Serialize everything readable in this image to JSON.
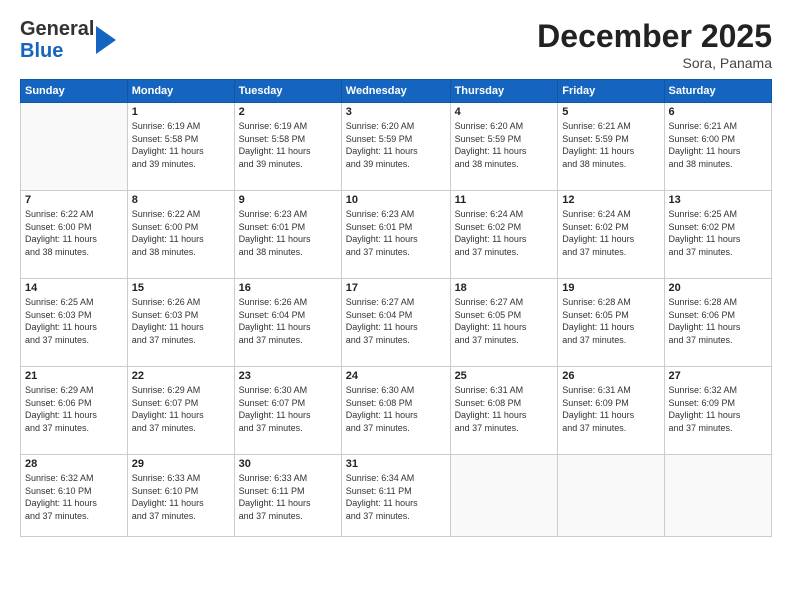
{
  "header": {
    "logo_general": "General",
    "logo_blue": "Blue",
    "month_title": "December 2025",
    "location": "Sora, Panama"
  },
  "weekdays": [
    "Sunday",
    "Monday",
    "Tuesday",
    "Wednesday",
    "Thursday",
    "Friday",
    "Saturday"
  ],
  "weeks": [
    [
      {
        "day": "",
        "info": ""
      },
      {
        "day": "1",
        "info": "Sunrise: 6:19 AM\nSunset: 5:58 PM\nDaylight: 11 hours\nand 39 minutes."
      },
      {
        "day": "2",
        "info": "Sunrise: 6:19 AM\nSunset: 5:58 PM\nDaylight: 11 hours\nand 39 minutes."
      },
      {
        "day": "3",
        "info": "Sunrise: 6:20 AM\nSunset: 5:59 PM\nDaylight: 11 hours\nand 39 minutes."
      },
      {
        "day": "4",
        "info": "Sunrise: 6:20 AM\nSunset: 5:59 PM\nDaylight: 11 hours\nand 38 minutes."
      },
      {
        "day": "5",
        "info": "Sunrise: 6:21 AM\nSunset: 5:59 PM\nDaylight: 11 hours\nand 38 minutes."
      },
      {
        "day": "6",
        "info": "Sunrise: 6:21 AM\nSunset: 6:00 PM\nDaylight: 11 hours\nand 38 minutes."
      }
    ],
    [
      {
        "day": "7",
        "info": "Sunrise: 6:22 AM\nSunset: 6:00 PM\nDaylight: 11 hours\nand 38 minutes."
      },
      {
        "day": "8",
        "info": "Sunrise: 6:22 AM\nSunset: 6:00 PM\nDaylight: 11 hours\nand 38 minutes."
      },
      {
        "day": "9",
        "info": "Sunrise: 6:23 AM\nSunset: 6:01 PM\nDaylight: 11 hours\nand 38 minutes."
      },
      {
        "day": "10",
        "info": "Sunrise: 6:23 AM\nSunset: 6:01 PM\nDaylight: 11 hours\nand 37 minutes."
      },
      {
        "day": "11",
        "info": "Sunrise: 6:24 AM\nSunset: 6:02 PM\nDaylight: 11 hours\nand 37 minutes."
      },
      {
        "day": "12",
        "info": "Sunrise: 6:24 AM\nSunset: 6:02 PM\nDaylight: 11 hours\nand 37 minutes."
      },
      {
        "day": "13",
        "info": "Sunrise: 6:25 AM\nSunset: 6:02 PM\nDaylight: 11 hours\nand 37 minutes."
      }
    ],
    [
      {
        "day": "14",
        "info": "Sunrise: 6:25 AM\nSunset: 6:03 PM\nDaylight: 11 hours\nand 37 minutes."
      },
      {
        "day": "15",
        "info": "Sunrise: 6:26 AM\nSunset: 6:03 PM\nDaylight: 11 hours\nand 37 minutes."
      },
      {
        "day": "16",
        "info": "Sunrise: 6:26 AM\nSunset: 6:04 PM\nDaylight: 11 hours\nand 37 minutes."
      },
      {
        "day": "17",
        "info": "Sunrise: 6:27 AM\nSunset: 6:04 PM\nDaylight: 11 hours\nand 37 minutes."
      },
      {
        "day": "18",
        "info": "Sunrise: 6:27 AM\nSunset: 6:05 PM\nDaylight: 11 hours\nand 37 minutes."
      },
      {
        "day": "19",
        "info": "Sunrise: 6:28 AM\nSunset: 6:05 PM\nDaylight: 11 hours\nand 37 minutes."
      },
      {
        "day": "20",
        "info": "Sunrise: 6:28 AM\nSunset: 6:06 PM\nDaylight: 11 hours\nand 37 minutes."
      }
    ],
    [
      {
        "day": "21",
        "info": "Sunrise: 6:29 AM\nSunset: 6:06 PM\nDaylight: 11 hours\nand 37 minutes."
      },
      {
        "day": "22",
        "info": "Sunrise: 6:29 AM\nSunset: 6:07 PM\nDaylight: 11 hours\nand 37 minutes."
      },
      {
        "day": "23",
        "info": "Sunrise: 6:30 AM\nSunset: 6:07 PM\nDaylight: 11 hours\nand 37 minutes."
      },
      {
        "day": "24",
        "info": "Sunrise: 6:30 AM\nSunset: 6:08 PM\nDaylight: 11 hours\nand 37 minutes."
      },
      {
        "day": "25",
        "info": "Sunrise: 6:31 AM\nSunset: 6:08 PM\nDaylight: 11 hours\nand 37 minutes."
      },
      {
        "day": "26",
        "info": "Sunrise: 6:31 AM\nSunset: 6:09 PM\nDaylight: 11 hours\nand 37 minutes."
      },
      {
        "day": "27",
        "info": "Sunrise: 6:32 AM\nSunset: 6:09 PM\nDaylight: 11 hours\nand 37 minutes."
      }
    ],
    [
      {
        "day": "28",
        "info": "Sunrise: 6:32 AM\nSunset: 6:10 PM\nDaylight: 11 hours\nand 37 minutes."
      },
      {
        "day": "29",
        "info": "Sunrise: 6:33 AM\nSunset: 6:10 PM\nDaylight: 11 hours\nand 37 minutes."
      },
      {
        "day": "30",
        "info": "Sunrise: 6:33 AM\nSunset: 6:11 PM\nDaylight: 11 hours\nand 37 minutes."
      },
      {
        "day": "31",
        "info": "Sunrise: 6:34 AM\nSunset: 6:11 PM\nDaylight: 11 hours\nand 37 minutes."
      },
      {
        "day": "",
        "info": ""
      },
      {
        "day": "",
        "info": ""
      },
      {
        "day": "",
        "info": ""
      }
    ]
  ]
}
